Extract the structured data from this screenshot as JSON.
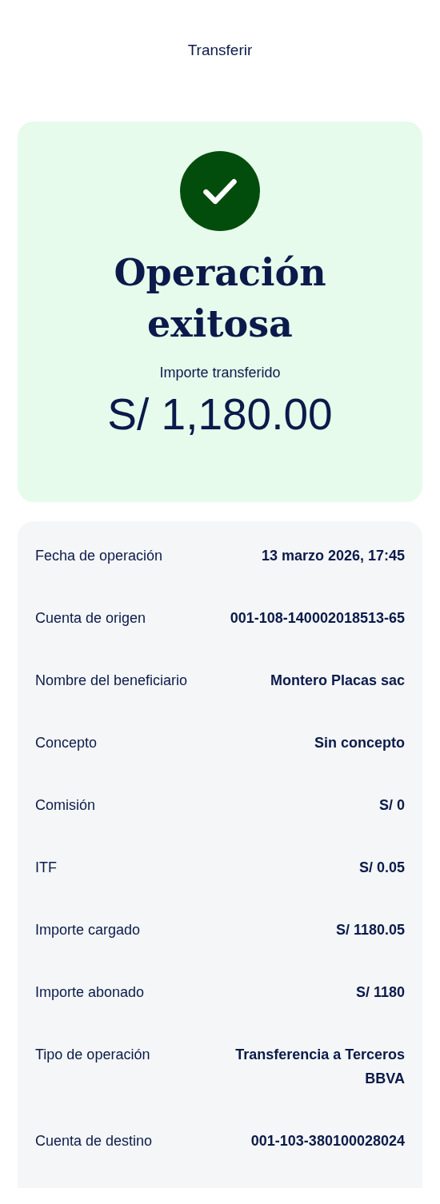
{
  "header": {
    "title": "Transferir"
  },
  "result": {
    "success": true,
    "heading": "Operación exitosa",
    "amount_label": "Importe transferido",
    "amount": "S/ 1,180.00"
  },
  "details": [
    {
      "label": "Fecha de operación",
      "value": "13 marzo 2026, 17:45"
    },
    {
      "label": "Cuenta de origen",
      "value": "001-108-140002018513-65"
    },
    {
      "label": "Nombre del beneficiario",
      "value": "Montero Placas sac"
    },
    {
      "label": "Concepto",
      "value": "Sin concepto"
    },
    {
      "label": "Comisión",
      "value": "S/ 0"
    },
    {
      "label": "ITF",
      "value": "S/ 0.05"
    },
    {
      "label": "Importe cargado",
      "value": "S/ 1180.05"
    },
    {
      "label": "Importe abonado",
      "value": "S/ 1180"
    },
    {
      "label": "Tipo de operación",
      "value": "Transferencia a Terceros BBVA"
    },
    {
      "label": "Cuenta de destino",
      "value": "001-103-380100028024"
    }
  ]
}
